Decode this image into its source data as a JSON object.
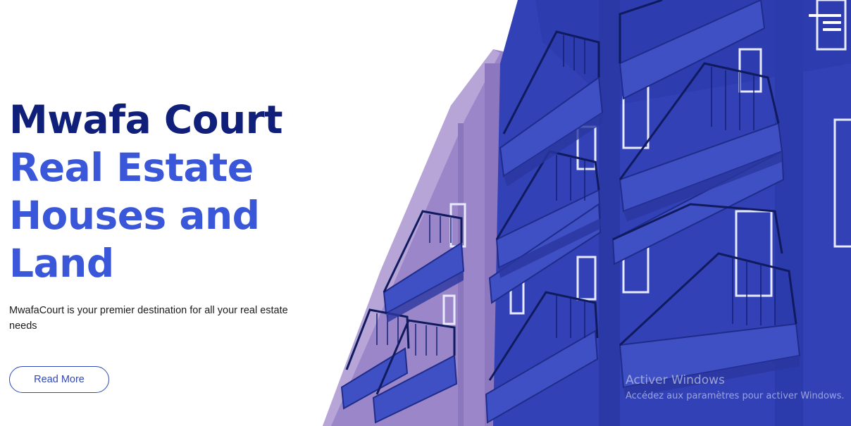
{
  "hero": {
    "title_line1": "Mwafa Court",
    "title_line2": "Real Estate",
    "title_line3": "Houses and",
    "title_line4": "Land",
    "description": "MwafaCourt is your premier destination for all your real estate needs",
    "cta_label": "Read More"
  },
  "nav": {
    "menu_icon": "hamburger-menu-icon"
  },
  "watermark": {
    "line1": "Activer Windows",
    "line2": "Accédez aux paramètres pour activer Windows."
  },
  "colors": {
    "title_dark": "#0f1f7a",
    "title_accent": "#3a57d9",
    "building_blue": "#3141b4",
    "building_pink": "#9b86c9",
    "button_border": "#3148b6"
  }
}
